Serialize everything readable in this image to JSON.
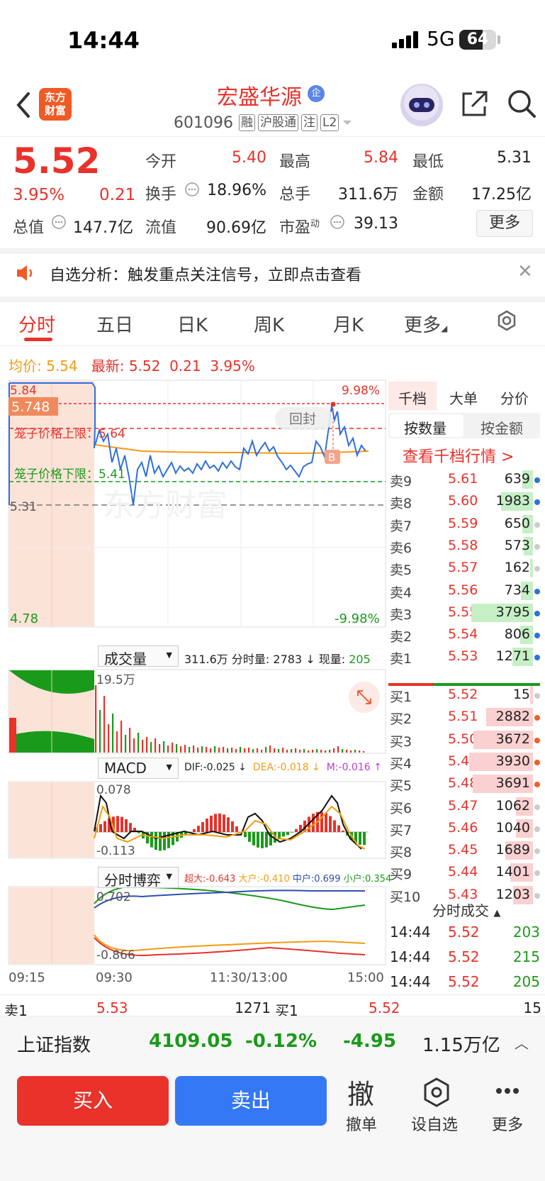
{
  "status_bar": {
    "time": "14:44",
    "network": "5G",
    "battery": "64",
    "battery_level": 0.64
  },
  "header": {
    "logo_line1": "东方",
    "logo_line2": "财富",
    "stock_name": "宏盛华源",
    "ent_badge": "企",
    "code": "601096",
    "tags": [
      "融",
      "沪股通",
      "注",
      "L2"
    ]
  },
  "quote": {
    "price": "5.52",
    "pct": "3.95%",
    "change": "0.21",
    "fields": [
      {
        "label": "今开",
        "value": "5.40",
        "color": "#e8322a"
      },
      {
        "label": "最高",
        "value": "5.84",
        "color": "#e8322a"
      },
      {
        "label": "最低",
        "value": "5.31",
        "color": "#222222"
      },
      {
        "label": "换手",
        "value": "18.96%",
        "color": "#222222"
      },
      {
        "label": "总手",
        "value": "311.6万",
        "color": "#222222"
      },
      {
        "label": "金额",
        "value": "17.25亿",
        "color": "#222222"
      },
      {
        "label": "总值",
        "value": "147.7亿",
        "color": "#222222"
      },
      {
        "label": "流值",
        "value": "90.69亿",
        "color": "#222222"
      },
      {
        "label": "市盈",
        "sup": "动",
        "value": "39.13",
        "color": "#222222"
      }
    ],
    "more_button": "更多"
  },
  "notice": {
    "text": "自选分析：触发重点关注信号，立即点击查看"
  },
  "tabs": [
    "分时",
    "五日",
    "日K",
    "周K",
    "月K",
    "更多"
  ],
  "avg_row": {
    "avg_label": "均价:",
    "avg_value": "5.54",
    "last_label": "最新:",
    "last_value": "5.52",
    "last_change": "0.21",
    "last_pct": "3.95%"
  },
  "chart_labels": {
    "high": "5.84",
    "cursor": "5.748",
    "low_price": "5.31",
    "bottom": "4.78",
    "up_limit": "9.98%",
    "down_limit": "-9.98%",
    "cage_up": "笼子价格上限：5.64",
    "cage_down": "笼子价格下限：5.41",
    "watermark": "东方财富",
    "huifeng": "回封",
    "b_mark": "B"
  },
  "volume_panel": {
    "selector": "成交量",
    "info_total": "311.6万",
    "info_min_label": "分时量:",
    "info_min": "2783 ↓",
    "info_now_label": "现量:",
    "info_now": "205",
    "axis_label": "19.5万"
  },
  "macd_panel": {
    "selector": "MACD",
    "dif": "DIF:-0.025 ↓",
    "dea": "DEA:-0.018 ↓",
    "m": "M:-0.016 ↑",
    "top": "0.078",
    "bottom": "-0.113"
  },
  "game_panel": {
    "selector": "分时博弈",
    "big": "超大:-0.643",
    "large": "大户:-0.410",
    "mid": "中户:0.699",
    "small": "小户:0.354",
    "top": "0.702",
    "bottom": "-0.866"
  },
  "time_axis": [
    "09:15",
    "09:30",
    "11:30/13:00",
    "15:00"
  ],
  "order_book": {
    "tabs": [
      "千档",
      "大单",
      "分价"
    ],
    "toggle": [
      "按数量",
      "按金额"
    ],
    "link": "查看千档行情 >",
    "asks": [
      {
        "label": "卖9",
        "price": "5.61",
        "volume": "639",
        "dot": "#2f6fe0"
      },
      {
        "label": "卖8",
        "price": "5.60",
        "volume": "1983",
        "dot": "#2f6fe0"
      },
      {
        "label": "卖7",
        "price": "5.59",
        "volume": "650",
        "dot": "#cccccc"
      },
      {
        "label": "卖6",
        "price": "5.58",
        "volume": "573",
        "dot": "#cccccc"
      },
      {
        "label": "卖5",
        "price": "5.57",
        "volume": "162",
        "dot": "#cccccc"
      },
      {
        "label": "卖4",
        "price": "5.56",
        "volume": "734",
        "dot": "#2f6fe0"
      },
      {
        "label": "卖3",
        "price": "5.55",
        "volume": "3795",
        "dot": "#2f6fe0"
      },
      {
        "label": "卖2",
        "price": "5.54",
        "volume": "806",
        "dot": "#2f6fe0"
      },
      {
        "label": "卖1",
        "price": "5.53",
        "volume": "1271",
        "dot": "#2f6fe0"
      }
    ],
    "bids": [
      {
        "label": "买1",
        "price": "5.52",
        "volume": "15",
        "dot": "#cccccc"
      },
      {
        "label": "买2",
        "price": "5.51",
        "volume": "2882",
        "dot": "#e8622a"
      },
      {
        "label": "买3",
        "price": "5.50",
        "volume": "3672",
        "dot": "#e8622a"
      },
      {
        "label": "买4",
        "price": "5.49",
        "volume": "3930",
        "dot": "#e8622a"
      },
      {
        "label": "买5",
        "price": "5.48",
        "volume": "3691",
        "dot": "#e8622a"
      },
      {
        "label": "买6",
        "price": "5.47",
        "volume": "1062",
        "dot": "#cccccc"
      },
      {
        "label": "买7",
        "price": "5.46",
        "volume": "1040",
        "dot": "#cccccc"
      },
      {
        "label": "买8",
        "price": "5.45",
        "volume": "1689",
        "dot": "#cccccc"
      },
      {
        "label": "买9",
        "price": "5.44",
        "volume": "1401",
        "dot": "#cccccc"
      },
      {
        "label": "买10",
        "price": "5.43",
        "volume": "1203",
        "dot": "#cccccc"
      }
    ]
  },
  "ticks": {
    "title": "分时成交",
    "rows": [
      {
        "time": "14:44",
        "price": "5.52",
        "volume": "203"
      },
      {
        "time": "14:44",
        "price": "5.52",
        "volume": "215"
      },
      {
        "time": "14:44",
        "price": "5.52",
        "volume": "205"
      }
    ]
  },
  "bottom_strip": {
    "ask_label": "卖1",
    "ask_price": "5.53",
    "ask_vol": "1271",
    "bid_label": "买1",
    "bid_price": "5.52",
    "bid_vol": "15"
  },
  "index_bar": {
    "name": "上证指数",
    "value": "4109.05",
    "pct": "-0.12%",
    "change": "-4.95",
    "turnover": "1.15万亿"
  },
  "actions": {
    "buy": "买入",
    "sell": "卖出",
    "cancel_icon": "撤",
    "cancel": "撤单",
    "watch": "设自选",
    "more": "更多"
  },
  "colors": {
    "up": "#e8322a",
    "down": "#1a9a1a",
    "avg": "#f39c12",
    "price_line": "#2f6fe0",
    "sell_button": "#3478f6"
  }
}
